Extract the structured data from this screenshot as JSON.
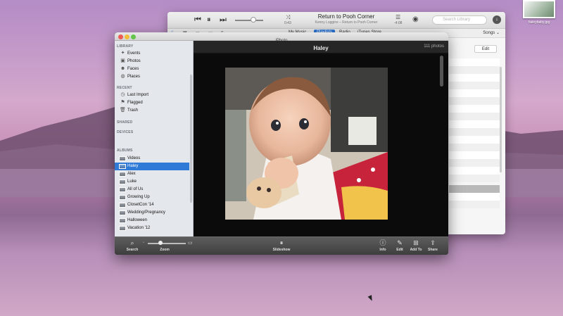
{
  "desktop": {
    "icon_label": "haleybaby.jpg"
  },
  "itunes": {
    "now_playing": {
      "song": "Return to Pooh Corner",
      "artist": "Kenny Loggins – Return to Pooh Corner",
      "elapsed": "0:43",
      "remaining": "-4:08"
    },
    "search_placeholder": "Search Library",
    "nav_tabs": [
      "My Music",
      "Playlists",
      "Radio",
      "iTunes Store"
    ],
    "active_tab": "Playlists",
    "view_selector": "Songs",
    "edit_label": "Edit"
  },
  "iphoto": {
    "window_title": "iPhoto",
    "sidebar": {
      "library_header": "LIBRARY",
      "library_items": [
        {
          "label": "Events",
          "icon": "events-icon"
        },
        {
          "label": "Photos",
          "icon": "photos-icon"
        },
        {
          "label": "Faces",
          "icon": "faces-icon"
        },
        {
          "label": "Places",
          "icon": "places-icon"
        }
      ],
      "recent_header": "RECENT",
      "recent_items": [
        {
          "label": "Last Import",
          "icon": "clock-icon"
        },
        {
          "label": "Flagged",
          "icon": "flag-icon"
        },
        {
          "label": "Trash",
          "icon": "trash-icon"
        }
      ],
      "shared_header": "SHARED",
      "devices_header": "DEVICES",
      "albums_header": "ALBUMS",
      "albums": [
        "Videos",
        "Haley",
        "Alex",
        "Luke",
        "All of Us",
        "Growing Up",
        "ClosetCon '14",
        "Wedding/Pregnancy",
        "Halloween",
        "Vacation '12"
      ],
      "selected_album": "Haley"
    },
    "header": {
      "title": "Haley",
      "count": "111 photos"
    },
    "toolbar": {
      "search": "Search",
      "zoom": "Zoom",
      "slideshow": "Slideshow",
      "info": "Info",
      "edit": "Edit",
      "add_to": "Add To",
      "share": "Share"
    }
  }
}
